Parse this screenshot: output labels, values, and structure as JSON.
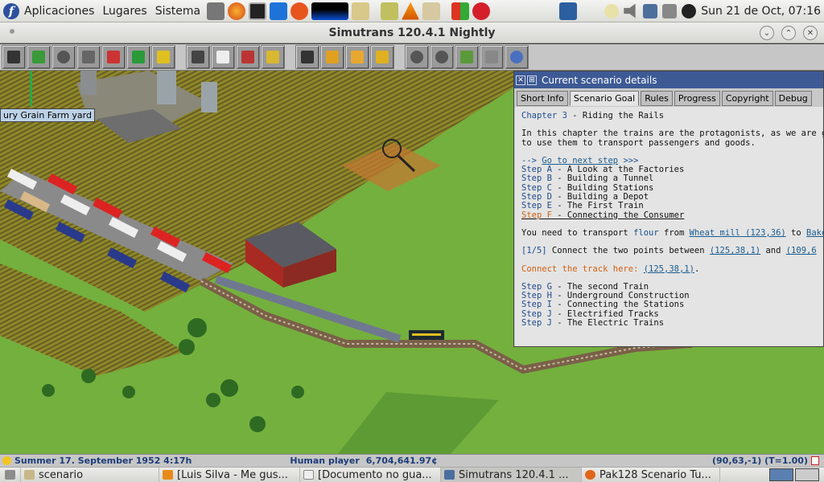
{
  "topbar": {
    "menu": [
      "Aplicaciones",
      "Lugares",
      "Sistema"
    ],
    "clock": "Sun 21 de Oct, 07:16"
  },
  "window": {
    "title": "Simutrans 120.4.1 Nightly"
  },
  "map": {
    "factory_label": "ury Grain Farm yard"
  },
  "scenario": {
    "title": "Current scenario details",
    "tabs": [
      "Short Info",
      "Scenario Goal",
      "Rules",
      "Progress",
      "Copyright",
      "Debug"
    ],
    "chapter_label": "Chapter 3",
    "chapter_sep": " - ",
    "chapter_name": "Riding the Rails",
    "intro1": "In this chapter the trains are the protagonists, as we are going",
    "intro2": "to use them to transport passengers and goods.",
    "next_prefix": "-->  ",
    "next_link": "Go to next step",
    "next_suffix": "  >>>",
    "steps_a": [
      {
        "code": "Step A",
        "name": "A Look at the Factories"
      },
      {
        "code": "Step B",
        "name": "Building a Tunnel"
      },
      {
        "code": "Step C",
        "name": "Building Stations"
      },
      {
        "code": "Step D",
        "name": "Building a Depot"
      },
      {
        "code": "Step E",
        "name": "The First Train"
      },
      {
        "code": "Step F",
        "name": "Connecting the Consumer"
      }
    ],
    "task_prefix": "You need to transport ",
    "task_good": "flour",
    "task_from": " from ",
    "task_source": "Wheat mill (123,36)",
    "task_to": " to ",
    "task_dest": "Bakery C",
    "sub_tag": "[1/5]",
    "sub_text": " Connect the two points between ",
    "sub_p1": "(125,38,1)",
    "sub_and": "  and  ",
    "sub_p2": "(109,6",
    "connect_label": "Connect the track here: ",
    "connect_coord": "(125,38,1)",
    "steps_b": [
      {
        "code": "Step G",
        "name": "The second Train"
      },
      {
        "code": "Step H",
        "name": "Underground Construction"
      },
      {
        "code": "Step I",
        "name": "Connecting the Stations"
      },
      {
        "code": "Step J",
        "name": "Electrified Tracks"
      },
      {
        "code": "Step J",
        "name": "The Electric Trains"
      }
    ],
    "dash": " - "
  },
  "status": {
    "date": "Summer 17. September 1952  4:17h",
    "player": "Human player",
    "money": "6,704,641.97¢",
    "coords": "(90,63,-1) (T=1.00)"
  },
  "taskbar": [
    {
      "label": "scenario"
    },
    {
      "label": "[Luis Silva - Me gus..."
    },
    {
      "label": "[Documento no gua..."
    },
    {
      "label": "Simutrans 120.4.1 ..."
    },
    {
      "label": "Pak128 Scenario Tu..."
    }
  ],
  "colors": {
    "accent": "#3d5a95",
    "link": "#1a5c90",
    "highlight": "#d06012"
  }
}
